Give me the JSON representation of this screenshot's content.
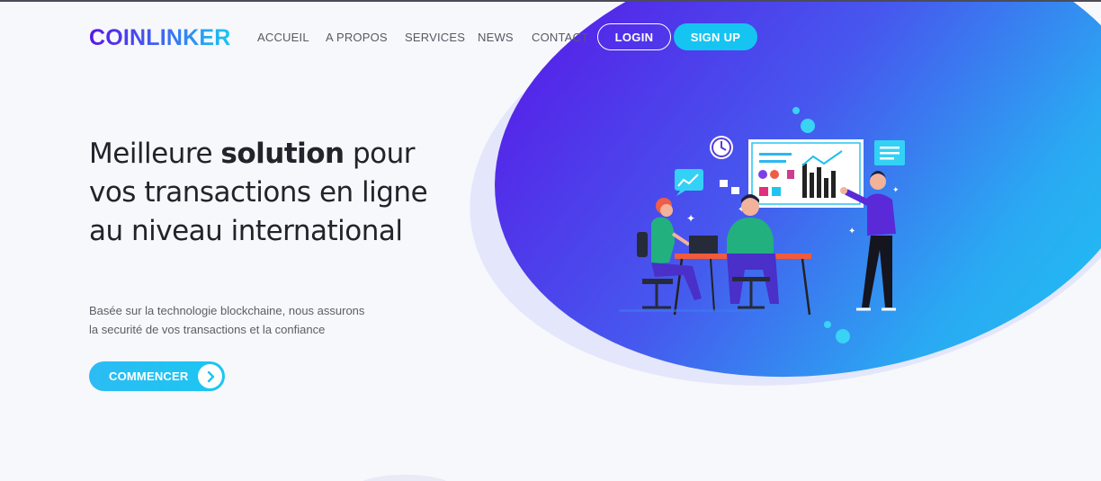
{
  "brand": {
    "name": "COINLINKER"
  },
  "nav": {
    "items": [
      {
        "label": "ACCUEIL"
      },
      {
        "label": "A PROPOS"
      },
      {
        "label": "SERVICES"
      },
      {
        "label": "NEWS"
      },
      {
        "label": "CONTACT"
      }
    ],
    "login_label": "LOGIN",
    "signup_label": "SIGN UP"
  },
  "hero": {
    "title_before": "Meilleure ",
    "title_bold": "solution",
    "title_after": " pour vos transactions en ligne au niveau international",
    "subtitle_line1": "Basée sur la technologie blockchaine, nous assurons",
    "subtitle_line2": "la securité de vos transactions et la confiance",
    "cta_label": "COMMENCER",
    "cta_icon": "chevron-right-icon"
  },
  "illustration": {
    "name": "team-meeting-illustration"
  },
  "colors": {
    "accent_purple": "#5a12e6",
    "accent_cyan": "#16c4f2",
    "text_dark": "#22232b",
    "nav_text": "#555a66"
  }
}
